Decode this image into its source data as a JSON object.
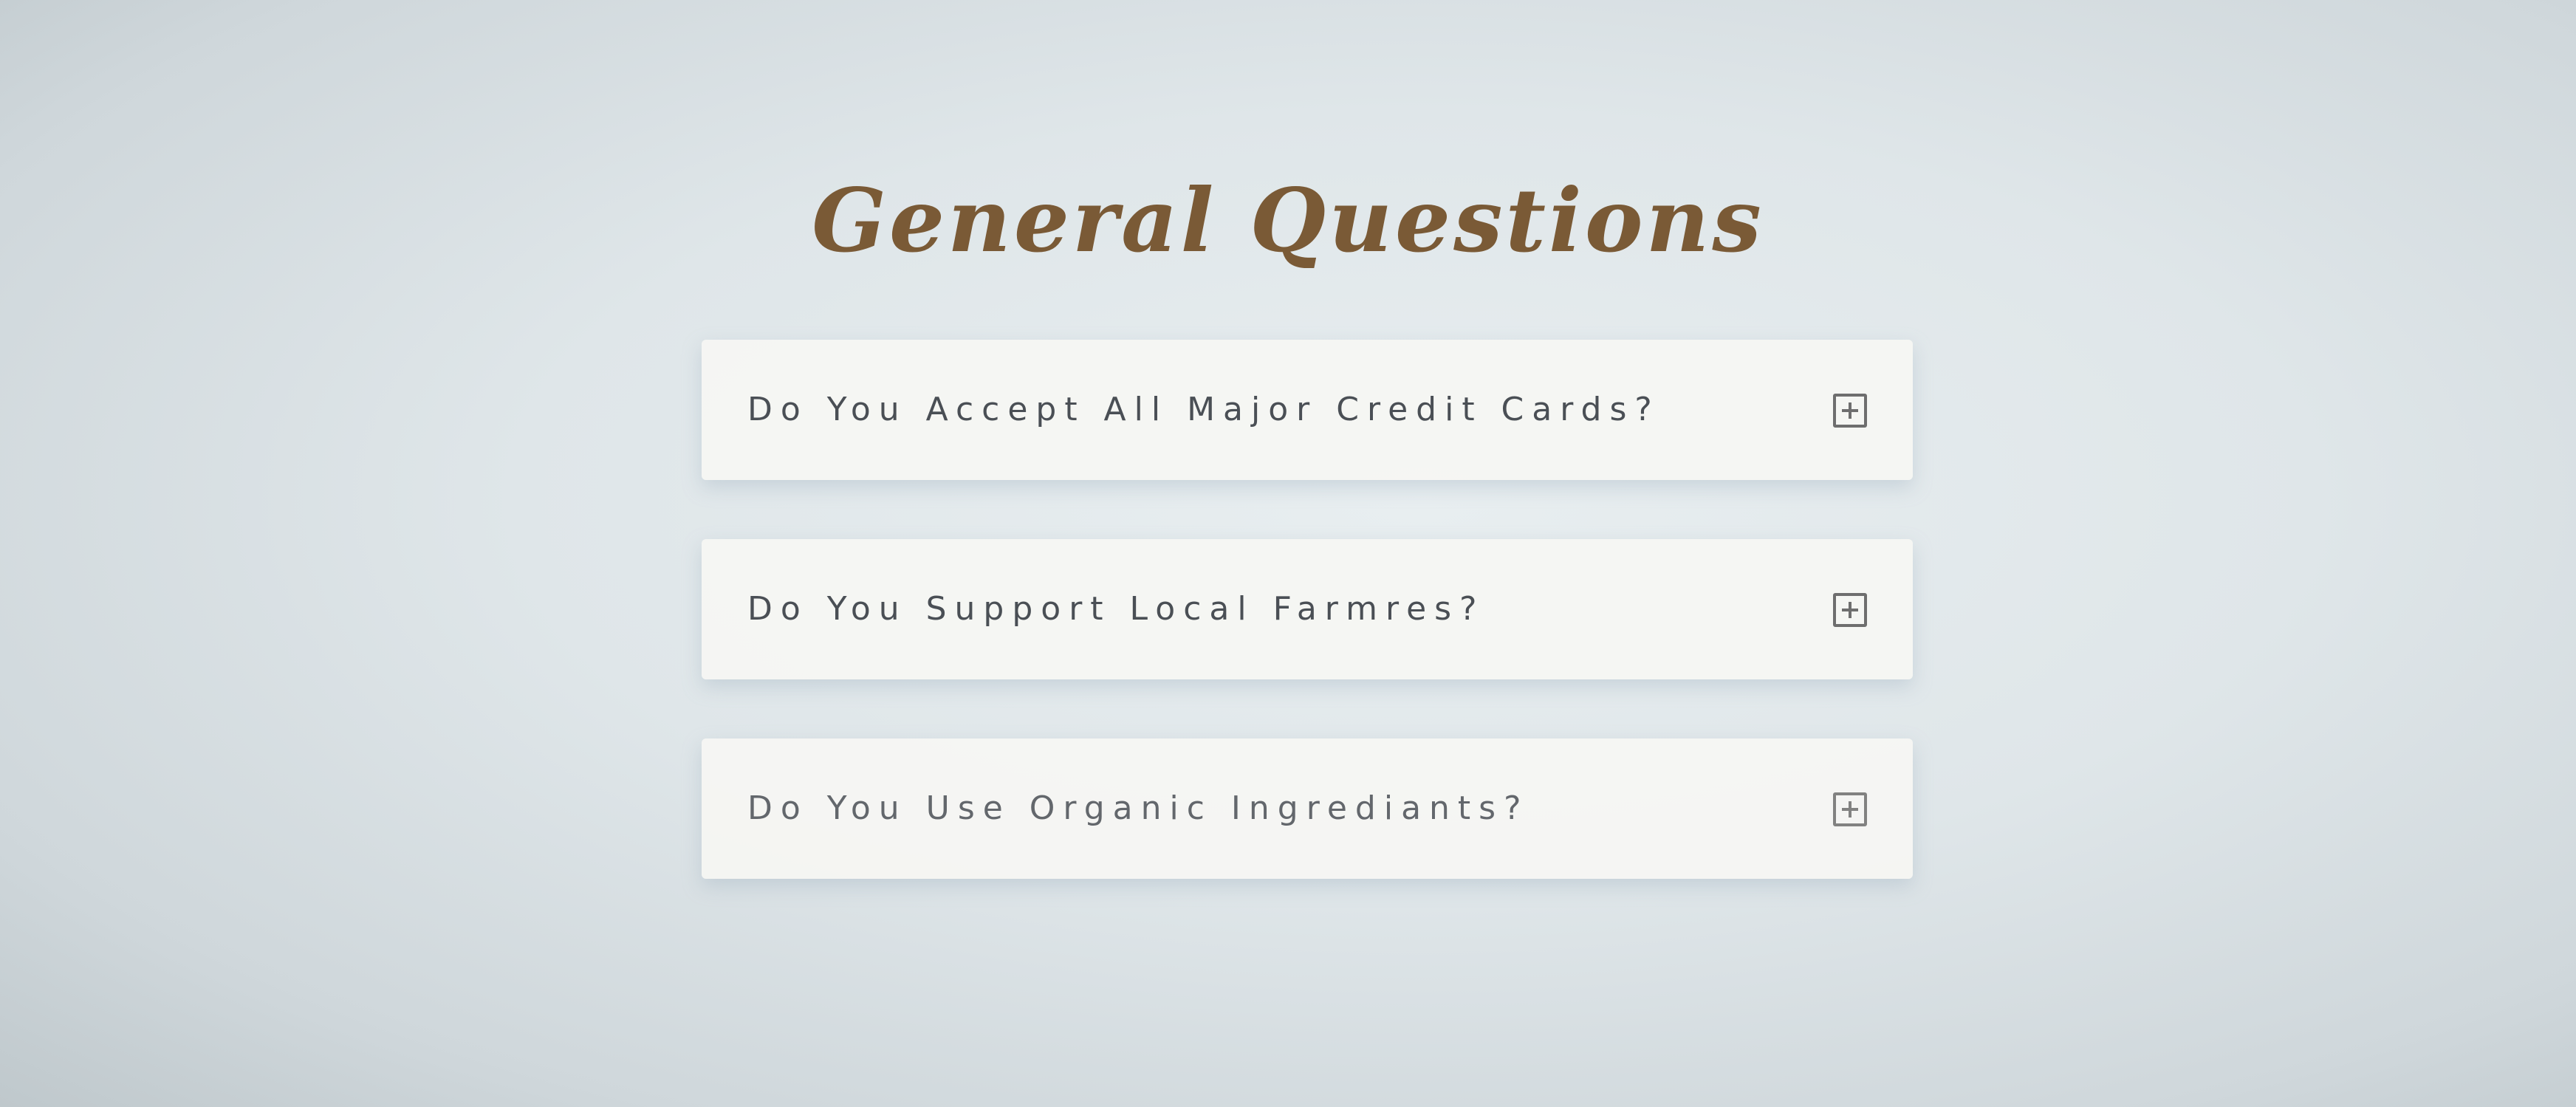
{
  "page": {
    "title": "General Questions",
    "title_color": "#7a5a36"
  },
  "faq": {
    "items": [
      {
        "question": "Do You Accept All Major Credit Cards?",
        "toggle_icon": "plus-square-icon",
        "expanded": false
      },
      {
        "question": "Do You Support Local Farmres?",
        "toggle_icon": "plus-square-icon",
        "expanded": false
      },
      {
        "question": "Do You Use Organic Ingrediants?",
        "toggle_icon": "plus-square-icon",
        "expanded": false
      }
    ]
  }
}
